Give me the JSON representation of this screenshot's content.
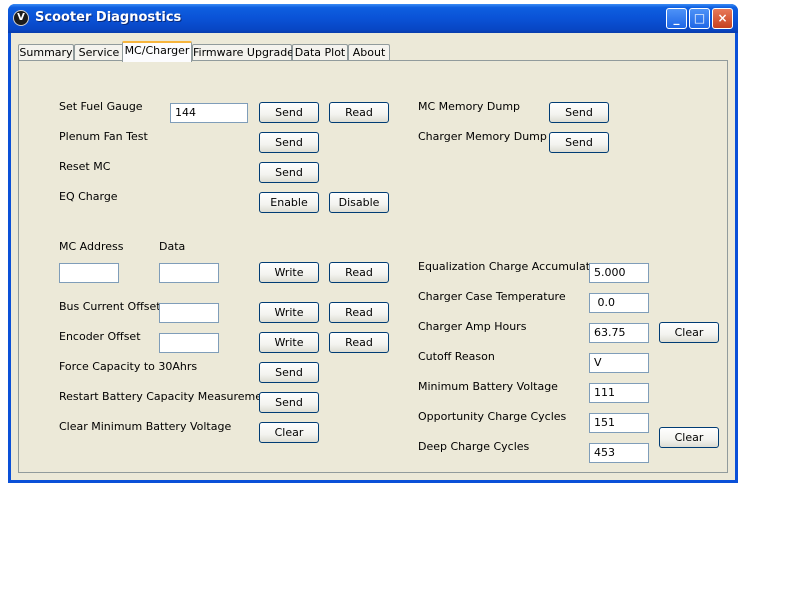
{
  "window": {
    "title": "Scooter Diagnostics",
    "icon": "scooter-logo-icon",
    "controls": {
      "minimize": "_",
      "maximize": "□",
      "close": "×"
    }
  },
  "tabs": [
    {
      "label": "Summary"
    },
    {
      "label": "Service"
    },
    {
      "label": "MC/Charger",
      "active": true
    },
    {
      "label": "Firmware Upgrade"
    },
    {
      "label": "Data Plot"
    },
    {
      "label": "About"
    }
  ],
  "left": {
    "fuel_gauge": {
      "label": "Set Fuel Gauge",
      "value": "144",
      "send": "Send",
      "read": "Read"
    },
    "plenum_fan": {
      "label": "Plenum Fan Test",
      "send": "Send"
    },
    "reset_mc": {
      "label": "Reset MC",
      "send": "Send"
    },
    "eq_charge": {
      "label": "EQ Charge",
      "enable": "Enable",
      "disable": "Disable"
    },
    "mc_address": {
      "label": "MC Address",
      "value": ""
    },
    "data": {
      "label": "Data",
      "value": "",
      "write": "Write",
      "read": "Read"
    },
    "bus_current": {
      "label": "Bus Current Offset",
      "value": "",
      "write": "Write",
      "read": "Read"
    },
    "encoder": {
      "label": "Encoder Offset",
      "value": "",
      "write": "Write",
      "read": "Read"
    },
    "force_capacity": {
      "label": "Force Capacity to 30Ahrs",
      "send": "Send"
    },
    "restart_battery": {
      "label": "Restart Battery Capacity Measurement",
      "send": "Send"
    },
    "clear_min_voltage": {
      "label": "Clear Minimum Battery Voltage",
      "clear": "Clear"
    }
  },
  "right": {
    "mc_memory_dump": {
      "label": "MC Memory Dump",
      "send": "Send"
    },
    "charger_memory_dump": {
      "label": "Charger Memory Dump",
      "send": "Send"
    },
    "eq_accumulator": {
      "label": "Equalization Charge Accumulator",
      "value": "5.000"
    },
    "case_temp": {
      "label": "Charger Case Temperature",
      "value": " 0.0"
    },
    "amp_hours": {
      "label": "Charger Amp Hours",
      "value": "63.75",
      "clear": "Clear"
    },
    "cutoff_reason": {
      "label": "Cutoff Reason",
      "value": "V"
    },
    "min_voltage": {
      "label": "Minimum Battery Voltage",
      "value": "111"
    },
    "opportunity_cycles": {
      "label": "Opportunity Charge Cycles",
      "value": "151"
    },
    "deep_cycles": {
      "label": "Deep Charge Cycles",
      "value": "453",
      "clear": "Clear"
    }
  }
}
